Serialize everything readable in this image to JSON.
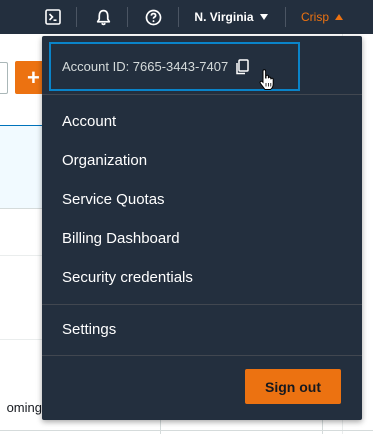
{
  "topnav": {
    "region": "N. Virginia",
    "account": "Crisp",
    "icons": [
      "cloudshell-icon",
      "bell-icon",
      "help-icon"
    ]
  },
  "background": {
    "partial_text": "oming"
  },
  "dropdown": {
    "account_id": "Account ID: 7665-3443-7407",
    "items": [
      {
        "label": "Account"
      },
      {
        "label": "Organization"
      },
      {
        "label": "Service Quotas"
      },
      {
        "label": "Billing Dashboard"
      },
      {
        "label": "Security credentials"
      }
    ],
    "settings": "Settings",
    "sign_out": "Sign out"
  },
  "colors": {
    "nav_bg": "#232f3e",
    "accent": "#ec7211",
    "focus_border": "#0a84c9"
  }
}
